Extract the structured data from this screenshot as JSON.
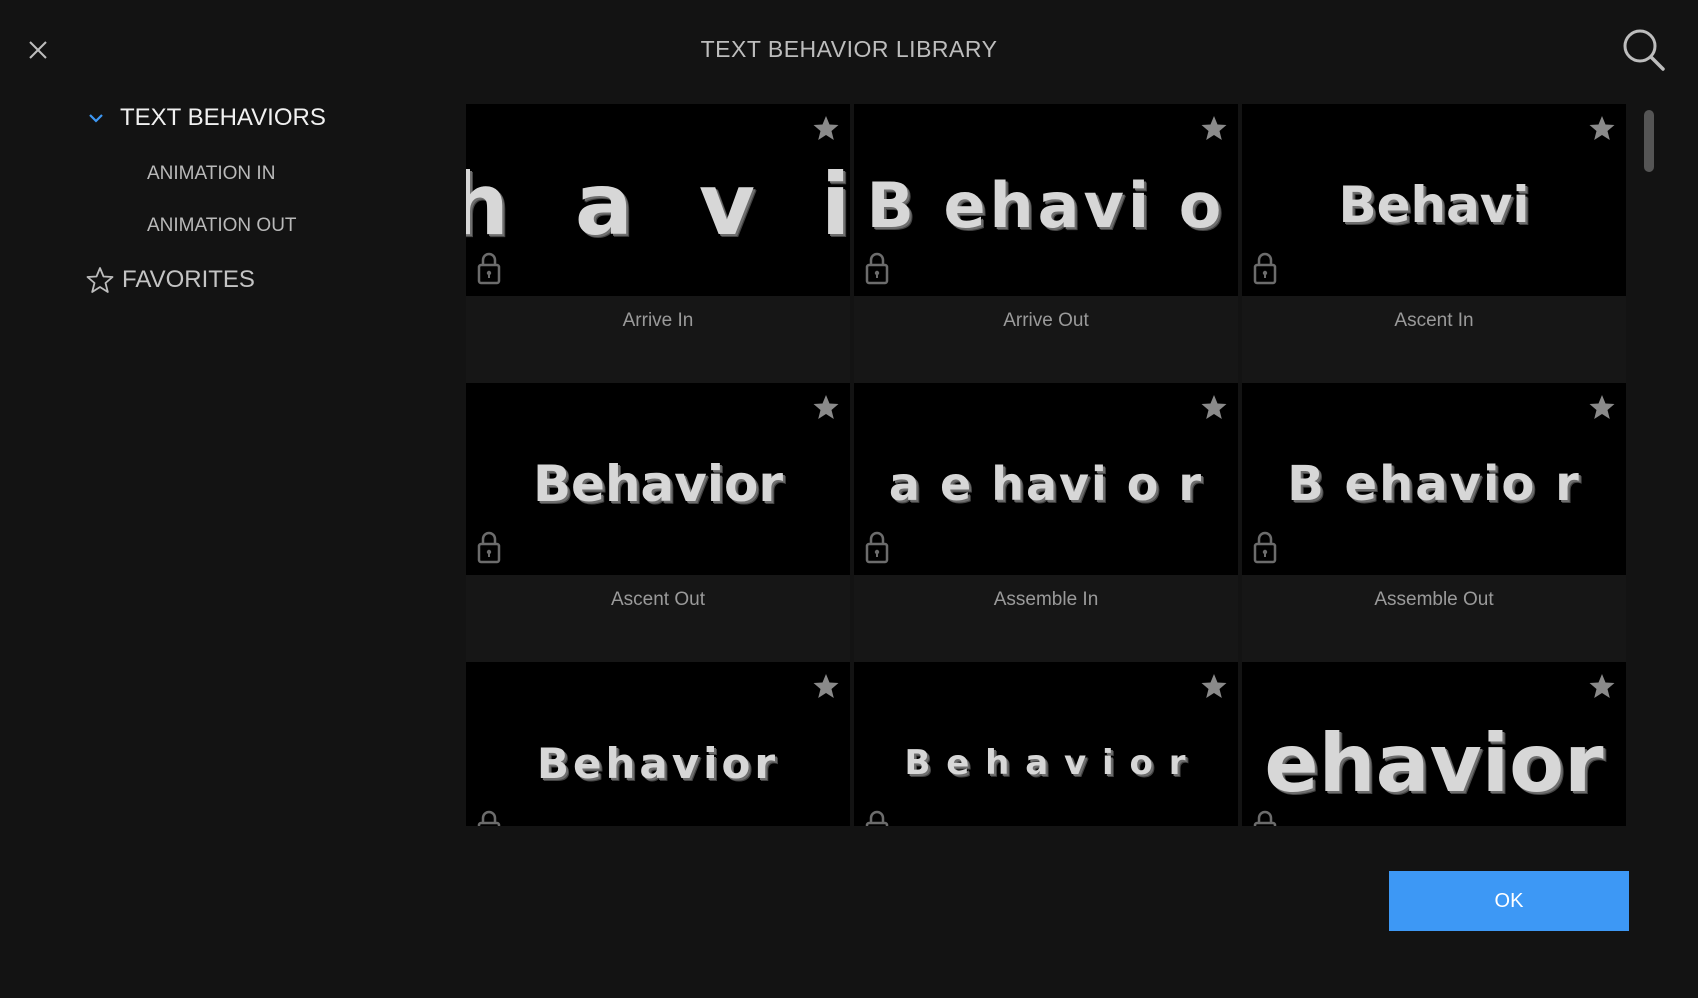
{
  "header": {
    "title": "TEXT BEHAVIOR LIBRARY",
    "close_icon": "close-icon",
    "search_icon": "search-icon"
  },
  "sidebar": {
    "section": {
      "label": "TEXT BEHAVIORS",
      "expanded": true,
      "items": [
        {
          "label": "ANIMATION IN"
        },
        {
          "label": "ANIMATION OUT"
        }
      ]
    },
    "favorites": {
      "label": "FAVORITES",
      "icon": "star-outline-icon"
    }
  },
  "tiles": [
    {
      "label": "Arrive In",
      "preview": "h a v i",
      "favorite": false,
      "locked": true
    },
    {
      "label": "Arrive Out",
      "preview": "B ehavi o",
      "favorite": false,
      "locked": true
    },
    {
      "label": "Ascent In",
      "preview": "Behavi",
      "favorite": false,
      "locked": true
    },
    {
      "label": "Ascent Out",
      "preview": "Behavior",
      "favorite": false,
      "locked": true
    },
    {
      "label": "Assemble In",
      "preview": "a  e havi o  r",
      "favorite": false,
      "locked": true
    },
    {
      "label": "Assemble Out",
      "preview": "B ehavio r",
      "favorite": false,
      "locked": true
    },
    {
      "label": "",
      "preview": "Behavior",
      "favorite": false,
      "locked": true
    },
    {
      "label": "",
      "preview": "B e h a v i o r",
      "favorite": false,
      "locked": true
    },
    {
      "label": "",
      "preview": "ehavior",
      "favorite": false,
      "locked": true
    }
  ],
  "footer": {
    "ok_label": "OK"
  },
  "colors": {
    "background": "#131313",
    "accent": "#3d98f5",
    "thumb_bg": "#000000",
    "icon_gray": "#8a8a8a"
  }
}
